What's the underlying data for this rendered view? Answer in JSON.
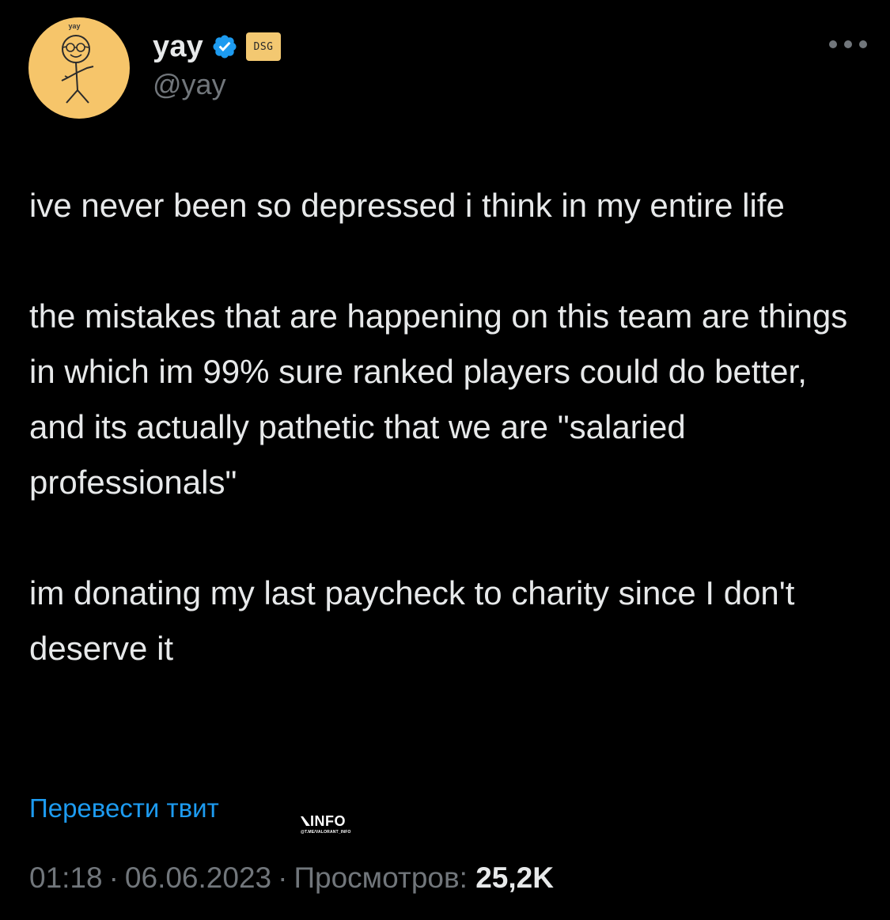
{
  "author": {
    "display_name": "yay",
    "handle": "@yay",
    "avatar_text": "yay",
    "avatar_icon": "stick-figure-avatar",
    "verified_icon": "verified-badge-icon",
    "affiliation_badge": "DSG",
    "avatar_bg": "#f6c56a",
    "verified_color": "#1d9bf0",
    "affiliation_color": "#f3c871"
  },
  "more_icon": "more-options-icon",
  "tweet": {
    "paragraphs": [
      "ive never been so depressed i think in my entire life",
      "the mistakes that are happening on this team are things in which im 99% sure ranked players could do better, and its actually pathetic that we are \"salaried professionals\"",
      "im donating my last paycheck to charity since I don't deserve it"
    ]
  },
  "translate_link": "Перевести твит",
  "watermark": {
    "main": "INFO",
    "sub": "@T.ME/VALORANT_INFO"
  },
  "meta": {
    "time": "01:18",
    "separator": "·",
    "date": "06.06.2023",
    "views_label": "Просмотров:",
    "views_count": "25,2K"
  },
  "colors": {
    "background": "#000000",
    "text": "#e7e9ea",
    "muted": "#71767b",
    "link": "#1d9bf0"
  }
}
